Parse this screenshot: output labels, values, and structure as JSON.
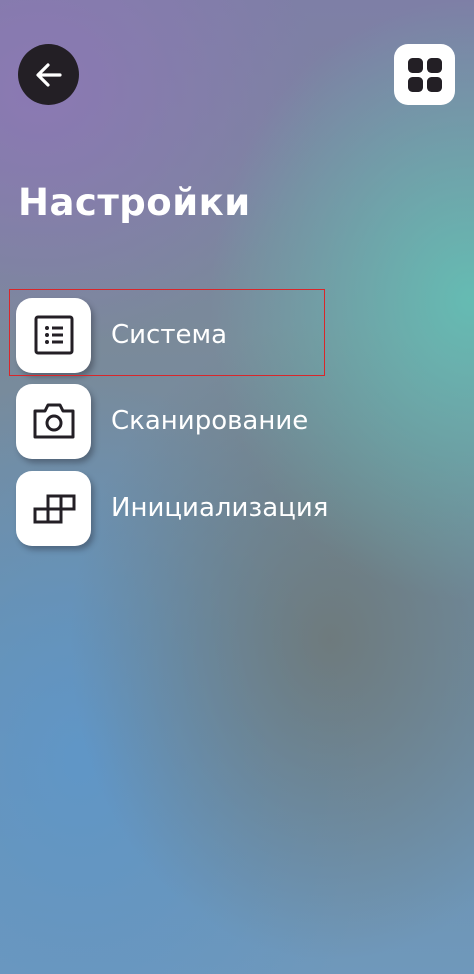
{
  "header": {
    "back_icon": "arrow-left-icon",
    "apps_icon": "grid-icon"
  },
  "page_title": "Настройки",
  "menu": {
    "items": [
      {
        "label": "Система",
        "icon": "list-icon",
        "highlighted": true
      },
      {
        "label": "Сканирование",
        "icon": "camera-icon",
        "highlighted": false
      },
      {
        "label": "Инициализация",
        "icon": "blocks-icon",
        "highlighted": false
      }
    ]
  },
  "colors": {
    "highlight_border": "#d9262a",
    "back_button_bg": "#231f25",
    "text": "#ffffff"
  }
}
